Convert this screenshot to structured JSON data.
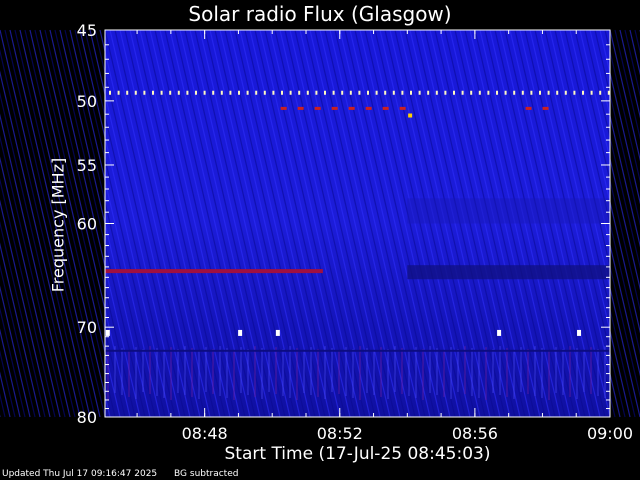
{
  "chart_data": {
    "type": "heatmap",
    "title": "Solar radio Flux (Glasgow)",
    "xlabel": "Start Time (17-Jul-25 08:45:03)",
    "ylabel": "Frequency [MHz]",
    "x_range": [
      "08:45:03",
      "09:00:00"
    ],
    "y_range_mhz": [
      45,
      80
    ],
    "y_scale": "log",
    "x_ticks": [
      "08:48",
      "08:52",
      "08:56",
      "09:00"
    ],
    "y_ticks": [
      45,
      50,
      55,
      60,
      70,
      80
    ],
    "features": [
      {
        "kind": "interference-dots-line",
        "freq_mhz": 49.4,
        "color": "#fff8c0"
      },
      {
        "kind": "intermittent-band",
        "freq_mhz": 50.6,
        "start": "08:50:15",
        "end": "08:54:05",
        "color": "#cc2020"
      },
      {
        "kind": "intermittent-band",
        "freq_mhz": 50.6,
        "start": "08:57:30",
        "end": "08:58:15",
        "color": "#cc2020"
      },
      {
        "kind": "continuous-band",
        "freq_mhz": 64.4,
        "start": "08:45:03",
        "end": "08:51:30",
        "color": "#a01040"
      },
      {
        "kind": "dim-band",
        "freq_mhz": 64.6,
        "start": "08:54:00",
        "end": "09:00:00",
        "color": "#101080"
      },
      {
        "kind": "spot-line",
        "freq_mhz": 70.6,
        "color": "#ffffff"
      }
    ],
    "colormap": [
      "#000060",
      "#1010c0",
      "#3030ff",
      "#ff3030",
      "#ffffa0"
    ],
    "grid": false
  },
  "footer": {
    "updated": "Updated Thu Jul 17 09:16:47 2025",
    "note": "BG subtracted"
  }
}
